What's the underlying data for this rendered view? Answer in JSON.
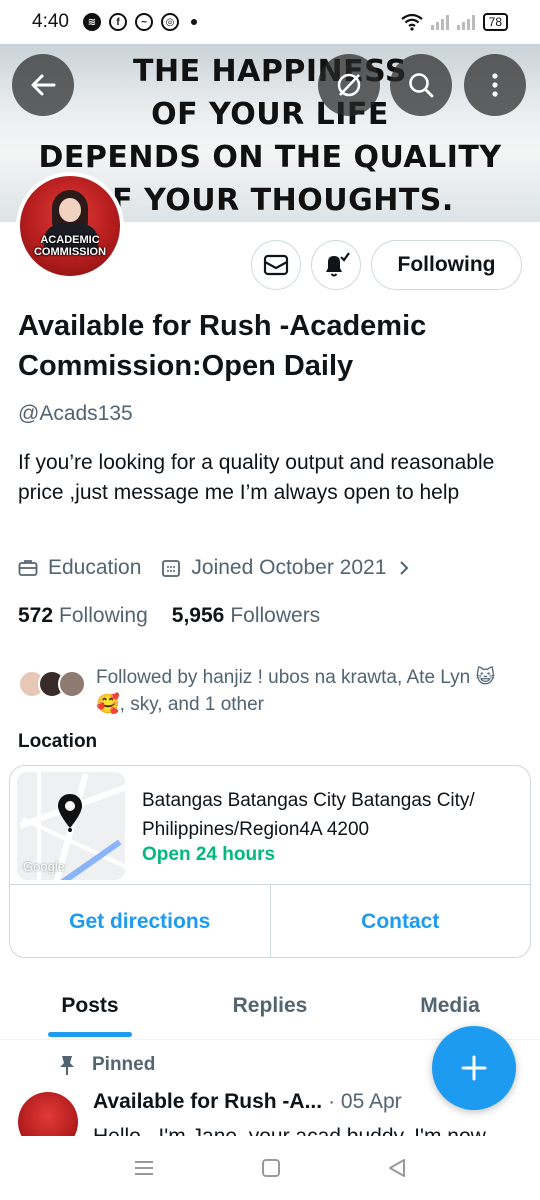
{
  "status_bar": {
    "time": "4:40",
    "battery": "78",
    "app_icons": [
      "spotify-icon",
      "facebook-icon",
      "messenger-icon",
      "instagram-icon"
    ]
  },
  "banner": {
    "quote_lines": [
      "THE HAPPINESS",
      "OF YOUR LIFE",
      "DEPENDS ON THE QUALITY",
      "OF YOUR THOUGHTS."
    ]
  },
  "avatar": {
    "label": "ACADEMIC COMMISSION"
  },
  "actions": {
    "following_label": "Following"
  },
  "profile": {
    "name": "Available for Rush -Academic Commission:Open Daily",
    "handle": "@Acads135",
    "bio": "If you’re looking for a quality output and reasonable price ,just message me I’m always open to help",
    "category": "Education",
    "joined": "Joined October 2021",
    "following_count": "572",
    "following_label": "Following",
    "followers_count": "5,956",
    "followers_label": "Followers",
    "followed_by": "Followed by hanjiz ! ubos na krawta, Ate Lyn 😺 🥰, sky, and 1 other"
  },
  "location": {
    "title": "Location",
    "address": "Batangas Batangas City Batangas City/ Philippines/Region4A 4200",
    "hours": "Open 24 hours",
    "map_watermark": "Google",
    "directions_label": "Get directions",
    "contact_label": "Contact"
  },
  "tabs": [
    "Posts",
    "Replies",
    "Media"
  ],
  "post": {
    "pinned_label": "Pinned",
    "author": "Available for Rush -A...",
    "date": "· 05 Apr",
    "body": "Hello , I'm Jane, your acad buddy. I'm now"
  },
  "colors": {
    "accent": "#1d9bf0",
    "open_green": "#00ba7c",
    "secondary_text": "#536471",
    "border": "#cfd9de"
  }
}
